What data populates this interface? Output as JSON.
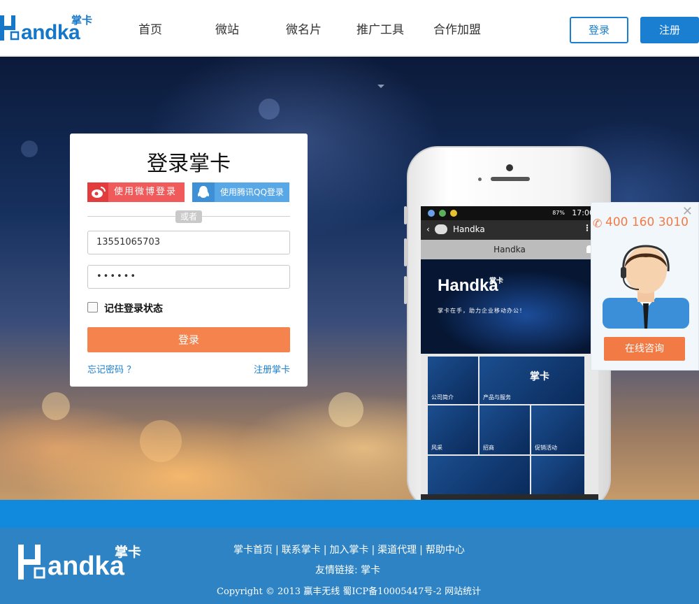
{
  "header": {
    "logo_word": "andka",
    "logo_cn": "掌卡",
    "nav": [
      "首页",
      "微站",
      "微名片",
      "推广工具",
      "合作加盟"
    ],
    "login_button": "登录",
    "register_button": "注册"
  },
  "login_card": {
    "title": "登录掌卡",
    "weibo_button": "使用微博登录",
    "qq_button": "使用腾讯QQ登录",
    "or_text": "或者",
    "username_value": "13551065703",
    "password_value": "••••••",
    "remember_label": "记住登录状态",
    "submit_label": "登录",
    "forgot_link": "忘记密码 ？",
    "register_link": "注册掌卡"
  },
  "phone_mock": {
    "status_time": "17:00",
    "status_battery": "87%",
    "wechat_title": "Handka",
    "sub_title": "Handka",
    "banner_word": "andka",
    "banner_cn": "掌卡",
    "banner_slogan": "掌卡在手，助力企业移动办公！",
    "tiles": [
      "公司简介",
      "产品与服务",
      "风采",
      "招商",
      "促销活动"
    ],
    "tile_logo": "掌卡"
  },
  "consult": {
    "hotline": "400 160 3010",
    "button": "在线咨询",
    "close_glyph": "✕"
  },
  "footer": {
    "logo_word": "andka",
    "logo_cn": "掌卡",
    "links": [
      "掌卡首页",
      "联系掌卡",
      "加入掌卡",
      "渠道代理",
      "帮助中心"
    ],
    "friend_links": "友情链接: 掌卡",
    "copyright": "Copyright © 2013 赢丰无线 蜀ICP备10005447号-2 网站统计"
  },
  "colors": {
    "brand_blue": "#1a7fd0",
    "accent_orange": "#f5834e",
    "weibo_red": "#f05a5a",
    "qq_blue": "#58a8e8",
    "footer_blue": "#2e83c4"
  }
}
